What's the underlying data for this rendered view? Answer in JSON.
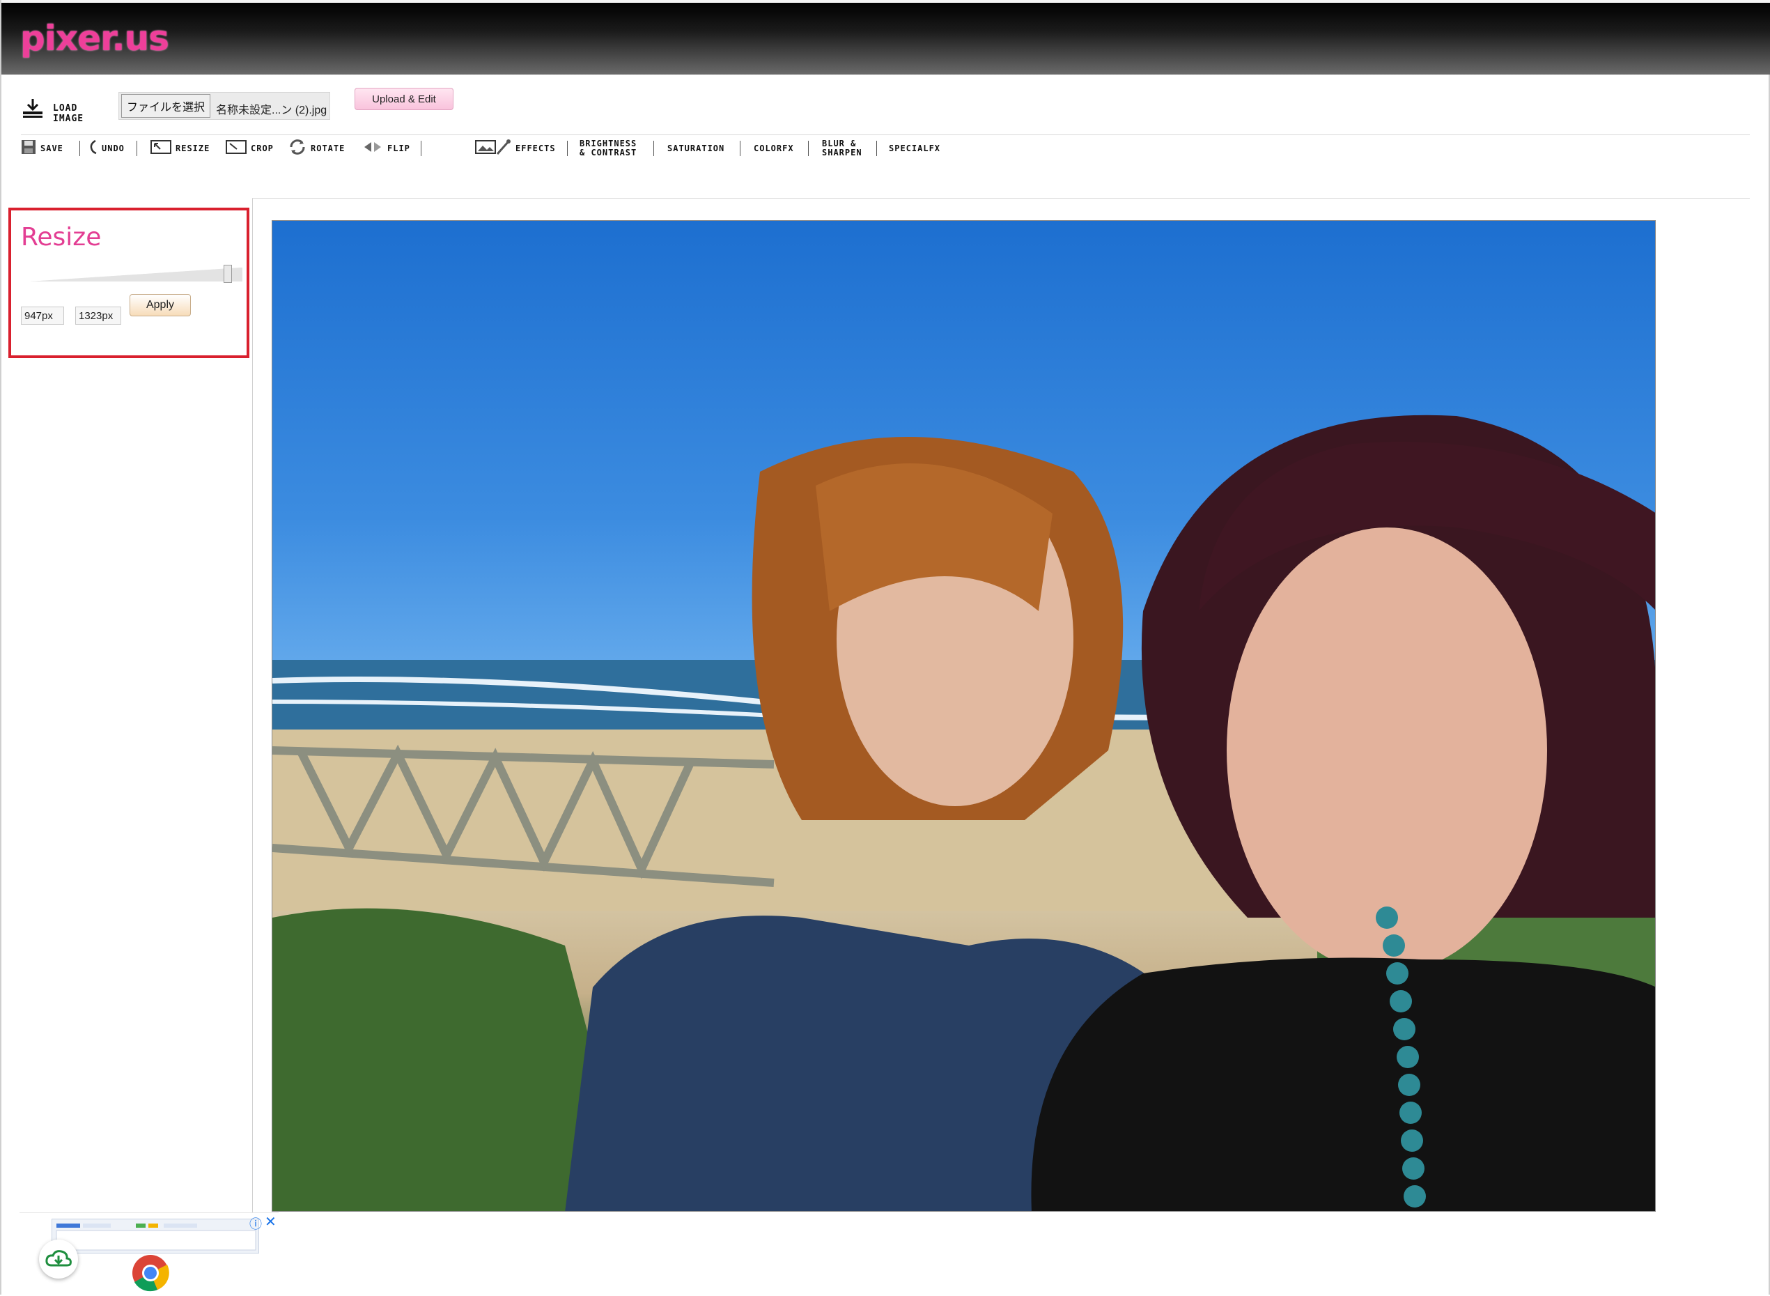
{
  "header": {
    "logo_text": "pixer.us"
  },
  "load": {
    "label": "Load Image",
    "file_button": "ファイルを選択",
    "file_name": "名称未設定...ン (2).jpg",
    "upload_button": "Upload & Edit"
  },
  "toolbar": {
    "save": "Save",
    "undo": "Undo",
    "resize": "Resize",
    "crop": "Crop",
    "rotate": "Rotate",
    "flip": "Flip",
    "effects": "Effects",
    "brightness_line1": "Brightness",
    "brightness_line2": "& Contrast",
    "saturation": "Saturation",
    "colorfx": "ColorFX",
    "blur_line1": "Blur &",
    "blur_line2": "Sharpen",
    "specialfx": "SpecialFX"
  },
  "resize_panel": {
    "title": "Resize",
    "width_value": "947px",
    "height_value": "1323px",
    "apply_button": "Apply",
    "slider_level": 0.95
  },
  "colors": {
    "brand_pink": "#ee3f9a",
    "title_pink": "#e33e93",
    "highlight_red": "#d9202e"
  },
  "icons": [
    "download-icon",
    "save-icon",
    "undo-icon",
    "resize-icon",
    "crop-icon",
    "rotate-icon",
    "flip-icon",
    "effects-icon",
    "cloud-download-icon",
    "chrome-icon",
    "info-icon",
    "close-icon"
  ]
}
